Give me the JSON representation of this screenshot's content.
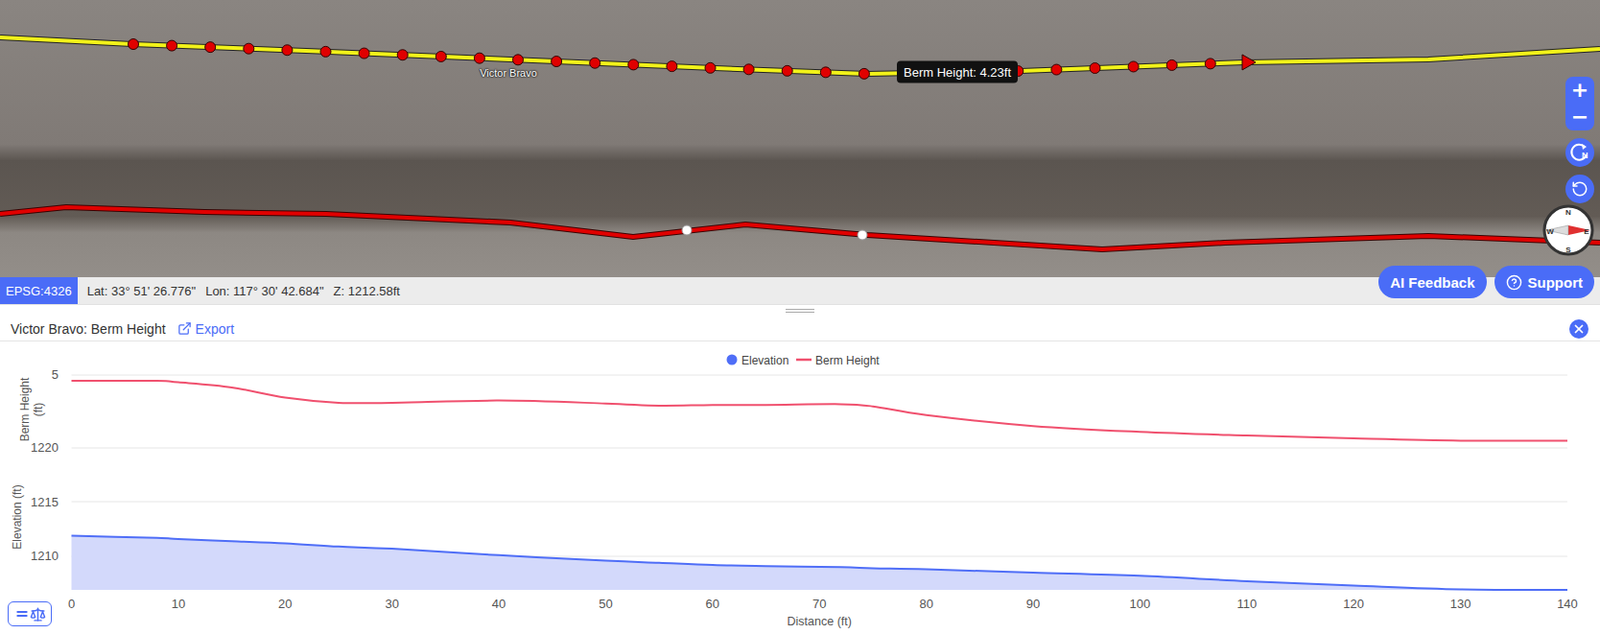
{
  "map": {
    "layer_label": "Victor Bravo",
    "tooltip": "Berm Height: 4.23ft",
    "zoom_in": "+",
    "zoom_out": "−",
    "rotate_north": "N",
    "compass": [
      "N",
      "E",
      "S",
      "W"
    ]
  },
  "coord_bar": {
    "crs": "EPSG:4326",
    "lat": "Lat: 33° 51' 26.776\"",
    "lon": "Lon: 117° 30' 42.684\"",
    "z": "Z: 1212.58ft"
  },
  "buttons": [
    "AI Feedback",
    "Support"
  ],
  "panel": {
    "title": "Victor Bravo: Berm Height",
    "export": "Export"
  },
  "chart": {
    "legend": [
      {
        "label": "Elevation",
        "kind": "dot",
        "color": "#4f6ef7"
      },
      {
        "label": "Berm Height",
        "kind": "line",
        "color": "#f0506e"
      }
    ],
    "berm_axis": {
      "title": [
        "Berm Height",
        "(ft)"
      ],
      "ticks": [
        "5"
      ]
    },
    "elevation_axis": {
      "title": "Elevation (ft)",
      "ticks": [
        "1220",
        "1215",
        "1210"
      ]
    },
    "x_axis": {
      "title": "Distance (ft)",
      "ticks": [
        "0",
        "10",
        "20",
        "30",
        "40",
        "50",
        "60",
        "70",
        "80",
        "90",
        "100",
        "110",
        "120",
        "130",
        "140"
      ]
    },
    "distance": [
      0,
      8,
      10,
      15,
      20,
      25,
      30,
      40,
      50,
      55,
      60,
      65,
      72,
      75,
      80,
      90,
      100,
      110,
      120,
      130,
      140
    ],
    "berm_height": [
      4.92,
      4.92,
      4.9,
      4.83,
      4.69,
      4.62,
      4.62,
      4.65,
      4.61,
      4.58,
      4.59,
      4.59,
      4.6,
      4.57,
      4.45,
      4.3,
      4.22,
      4.17,
      4.13,
      4.1,
      4.1
    ],
    "elevation": [
      1211.9,
      1211.7,
      1211.6,
      1211.4,
      1211.2,
      1210.9,
      1210.7,
      1210.1,
      1209.6,
      1209.4,
      1209.2,
      1209.1,
      1209.0,
      1208.9,
      1208.8,
      1208.5,
      1208.2,
      1207.7,
      1207.3,
      1206.95,
      1206.9
    ]
  }
}
